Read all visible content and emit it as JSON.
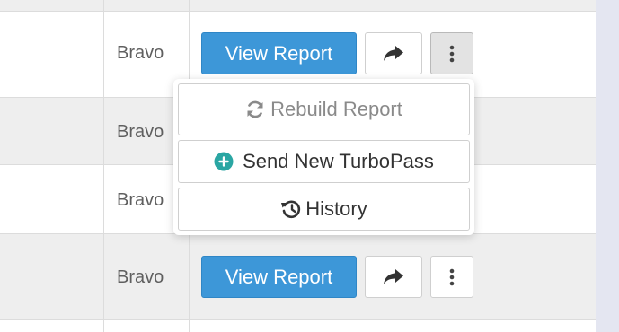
{
  "rows": [
    {
      "name": ""
    },
    {
      "name": "Bravo",
      "view_label": "View Report"
    },
    {
      "name": "Bravo"
    },
    {
      "name": "Bravo"
    },
    {
      "name": "Bravo",
      "view_label": "View Report"
    },
    {
      "name": ""
    }
  ],
  "menu": {
    "rebuild_label": "Rebuild Report",
    "send_label": "Send New TurboPass",
    "history_label": "History"
  },
  "colors": {
    "primary": "#3d97d8",
    "accent_teal": "#2aa6a3",
    "row_alt": "#eeeeee",
    "rail": "#e4e6f1"
  },
  "icons": {
    "share": "share-arrow-icon",
    "more": "vertical-ellipsis-icon",
    "rebuild": "refresh-icon",
    "send": "plus-circle-icon",
    "history": "history-icon"
  }
}
